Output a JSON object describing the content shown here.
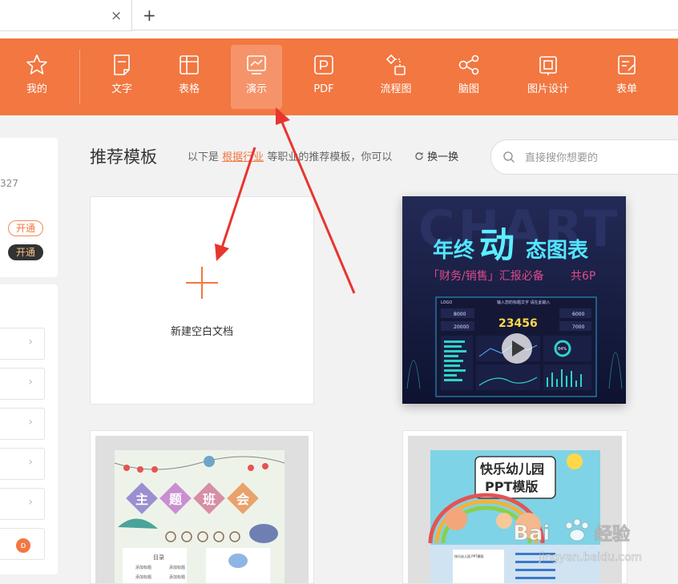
{
  "tabbar": {
    "close_icon": "×",
    "add_icon": "+"
  },
  "toolbar": {
    "items": [
      {
        "label": "我的",
        "icon": "star-icon"
      },
      {
        "label": "文字",
        "icon": "document-icon"
      },
      {
        "label": "表格",
        "icon": "spreadsheet-icon"
      },
      {
        "label": "演示",
        "icon": "presentation-icon",
        "active": true
      },
      {
        "label": "PDF",
        "icon": "pdf-icon"
      },
      {
        "label": "流程图",
        "icon": "flowchart-icon"
      },
      {
        "label": "脑图",
        "icon": "mindmap-icon"
      },
      {
        "label": "图片设计",
        "icon": "image-design-icon"
      },
      {
        "label": "表单",
        "icon": "form-icon"
      }
    ],
    "accent_color": "#f27741"
  },
  "left_panel": {
    "number_fragment": "327",
    "pill_outline": "开通",
    "pill_dark": "开通",
    "chevron": "›",
    "logo_glyph": "ɒ"
  },
  "header": {
    "title": "推荐模板",
    "subtitle_prefix": "以下是",
    "subtitle_link": "根据行业",
    "subtitle_suffix": "等职业的推荐模板，你可以",
    "refresh_label": "换一换"
  },
  "search": {
    "placeholder": "直接搜你想要的"
  },
  "new_doc": {
    "label": "新建空白文档"
  },
  "templates": {
    "t1": {
      "bg_word": "CHART",
      "line1a": "年终",
      "line1b": "动",
      "line1c": "态图表",
      "line2": "「财务/销售」汇报必备",
      "line2b": "共6P",
      "dash_header": "输入您的标题文字 请在此输入",
      "big_number": "23456",
      "small1": "8000",
      "small2": "20000",
      "small3": "6000",
      "small4": "7000",
      "logo": "LOGO",
      "percent": "84%"
    },
    "t2": {
      "title": "主题班会",
      "chars": [
        "主",
        "题",
        "班",
        "会"
      ],
      "toc": "目录",
      "items": [
        "添加标题",
        "添加标题",
        "添加标题",
        "添加标题"
      ]
    },
    "t3": {
      "line1": "快乐幼儿园",
      "line2": "PPT模版",
      "mini": "快乐幼儿园 PPT模版"
    }
  },
  "watermark": {
    "text1": "Bai",
    "text2": "经验",
    "url": "jingyan.baidu.com"
  }
}
